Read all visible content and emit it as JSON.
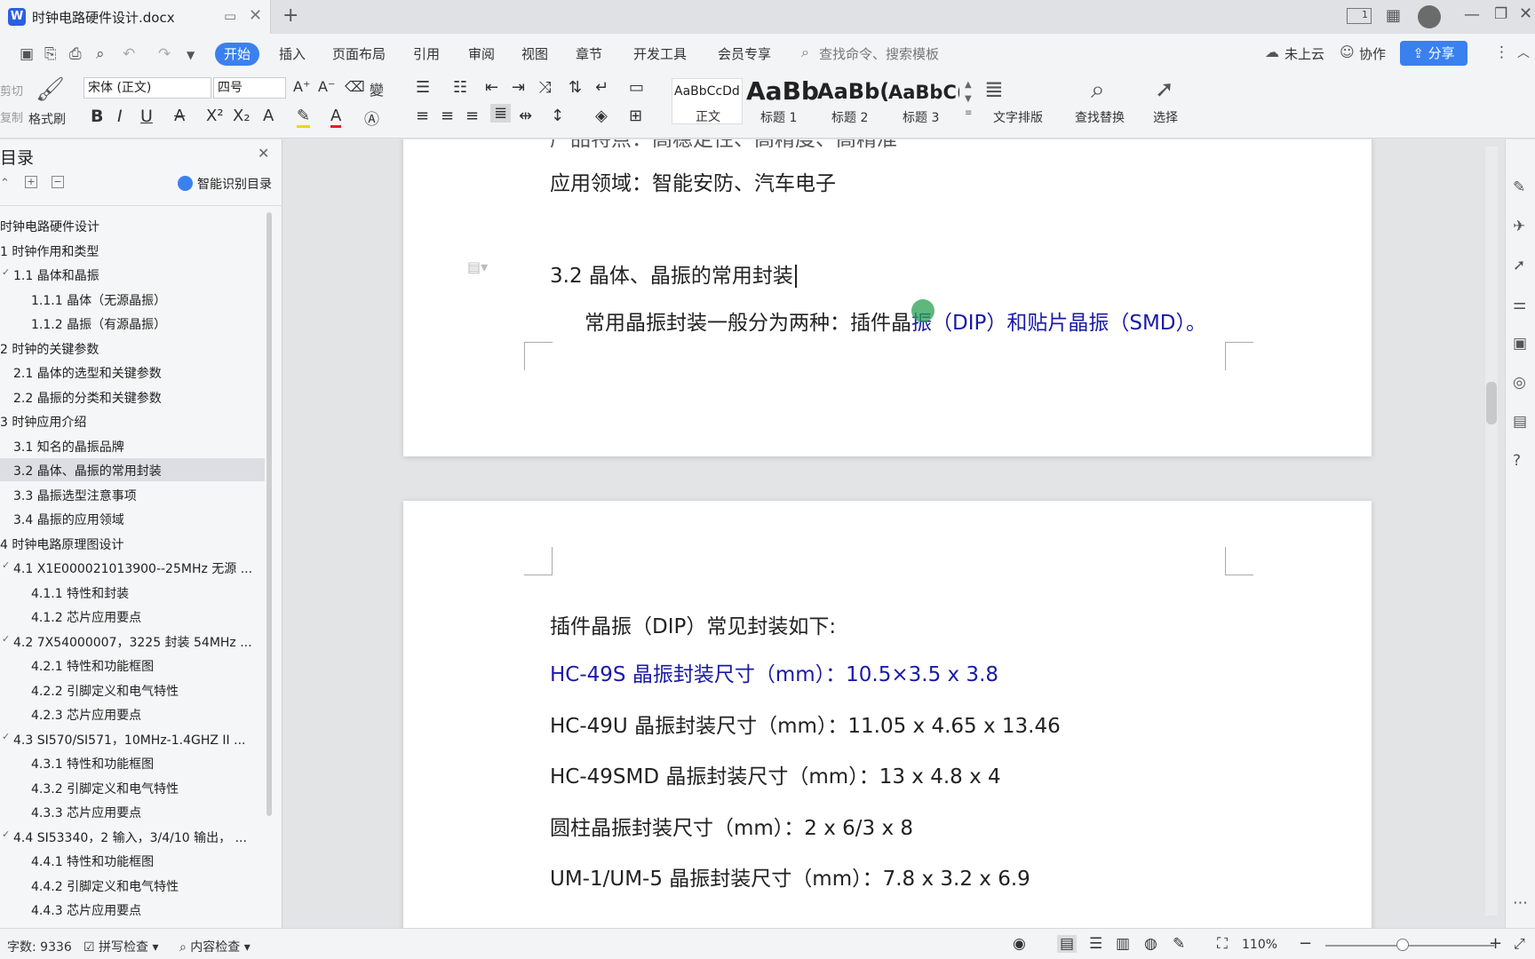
{
  "titlebar": {
    "doc_title": "时钟电路硬件设计.docx",
    "new_tab": "+",
    "page_badge": "1"
  },
  "menubar": {
    "tabs": [
      "开始",
      "插入",
      "页面布局",
      "引用",
      "审阅",
      "视图",
      "章节",
      "开发工具",
      "会员专享"
    ],
    "search_placeholder": "查找命令、搜索模板",
    "cloud": "未上云",
    "collab": "协作",
    "share": "分享"
  },
  "ribbon": {
    "cut": "剪切",
    "copy": "复制",
    "format_painter": "格式刷",
    "font_name": "宋体 (正文)",
    "font_size": "四号",
    "styles": [
      {
        "preview": "AaBbCcDd",
        "name": "正文"
      },
      {
        "preview": "AaBb",
        "name": "标题 1"
      },
      {
        "preview": "AaBb(",
        "name": "标题 2"
      },
      {
        "preview": "AaBbC(",
        "name": "标题 3"
      }
    ],
    "text_layout": "文字排版",
    "find_replace": "查找替换",
    "select": "选择"
  },
  "sidebar": {
    "title": "目录",
    "smart": "智能识别目录",
    "items": [
      {
        "text": "时钟电路硬件设计",
        "level": 0
      },
      {
        "text": "1  时钟作用和类型",
        "level": 0
      },
      {
        "text": "1.1  晶体和晶振",
        "level": 1,
        "arrow": true
      },
      {
        "text": "1.1.1  晶体（无源晶振）",
        "level": 2
      },
      {
        "text": "1.1.2  晶振（有源晶振）",
        "level": 2
      },
      {
        "text": "2  时钟的关键参数",
        "level": 0
      },
      {
        "text": "2.1  晶体的选型和关键参数",
        "level": 1
      },
      {
        "text": "2.2  晶振的分类和关键参数",
        "level": 1
      },
      {
        "text": "3  时钟应用介绍",
        "level": 0
      },
      {
        "text": "3.1  知名的晶振品牌",
        "level": 1
      },
      {
        "text": "3.2  晶体、晶振的常用封装",
        "level": 1,
        "active": true
      },
      {
        "text": "3.3  晶振选型注意事项",
        "level": 1
      },
      {
        "text": "3.4  晶振的应用领域",
        "level": 1
      },
      {
        "text": "4  时钟电路原理图设计",
        "level": 0
      },
      {
        "text": "4.1  X1E000021013900--25MHz 无源 ...",
        "level": 1,
        "arrow": true
      },
      {
        "text": "4.1.1  特性和封装",
        "level": 2
      },
      {
        "text": "4.1.2  芯片应用要点",
        "level": 2
      },
      {
        "text": "4.2  7X54000007，3225 封装 54MHz ...",
        "level": 1,
        "arrow": true
      },
      {
        "text": "4.2.1  特性和功能框图",
        "level": 2
      },
      {
        "text": "4.2.2  引脚定义和电气特性",
        "level": 2
      },
      {
        "text": "4.2.3  芯片应用要点",
        "level": 2
      },
      {
        "text": "4.3  SI570/SI571，10MHz-1.4GHZ II ...",
        "level": 1,
        "arrow": true
      },
      {
        "text": "4.3.1  特性和功能框图",
        "level": 2
      },
      {
        "text": "4.3.2  引脚定义和电气特性",
        "level": 2
      },
      {
        "text": "4.3.3  芯片应用要点",
        "level": 2
      },
      {
        "text": "4.4  SI53340，2 输入，3/4/10 输出， ...",
        "level": 1,
        "arrow": true
      },
      {
        "text": "4.4.1  特性和功能框图",
        "level": 2
      },
      {
        "text": "4.4.2  引脚定义和电气特性",
        "level": 2
      },
      {
        "text": "4.4.3  芯片应用要点",
        "level": 2
      }
    ]
  },
  "document": {
    "partial_line": "产品特点：高稳定性、高精度、高精准",
    "app_field": "应用领域：智能安防、汽车电子",
    "heading": "3.2  晶体、晶振的常用封装",
    "para_black": "常用晶振封装一般分为两种：插件晶",
    "para_blue": "振（DIP）和贴片晶振（SMD）。",
    "dip_title": "插件晶振（DIP）常见封装如下:",
    "lines": [
      {
        "text": "HC-49S 晶振封装尺寸（mm）：10.5×3.5 x 3.8",
        "blue": true
      },
      {
        "text": "HC-49U 晶振封装尺寸（mm）：11.05 x 4.65 x 13.46",
        "blue": false
      },
      {
        "text": "HC-49SMD 晶振封装尺寸（mm）：13 x 4.8 x 4",
        "blue": false
      },
      {
        "text": "圆柱晶振封装尺寸（mm）：2 x 6/3 x 8",
        "blue": false
      },
      {
        "text": "UM-1/UM-5 晶振封装尺寸（mm）：7.8 x 3.2 x 6.9",
        "blue": false
      }
    ]
  },
  "status": {
    "word_count": "字数: 9336",
    "spell_check": "拼写检查",
    "content_check": "内容检查",
    "zoom": "110%"
  },
  "colors": {
    "accent": "#3b80ef",
    "link_blue": "#1a1aa8"
  }
}
